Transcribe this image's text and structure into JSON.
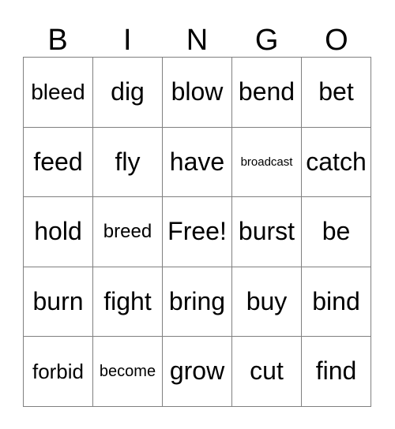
{
  "card": {
    "title_letters": [
      "B",
      "I",
      "N",
      "G",
      "O"
    ],
    "columns": 5,
    "rows": 5,
    "free_space_label": "Free!",
    "border_color": "#808080",
    "text_color": "#000000",
    "background_color": "#ffffff",
    "grid": [
      [
        {
          "label": "bleed",
          "size": "xl"
        },
        {
          "label": "dig",
          "size": "xxl"
        },
        {
          "label": "blow",
          "size": "xxl"
        },
        {
          "label": "bend",
          "size": "xxl"
        },
        {
          "label": "bet",
          "size": "xxl"
        }
      ],
      [
        {
          "label": "feed",
          "size": "xxl"
        },
        {
          "label": "fly",
          "size": "xxl"
        },
        {
          "label": "have",
          "size": "xxl"
        },
        {
          "label": "broadcast",
          "size": "xs"
        },
        {
          "label": "catch",
          "size": "xxl"
        }
      ],
      [
        {
          "label": "hold",
          "size": "xxl"
        },
        {
          "label": "breed",
          "size": "m"
        },
        {
          "label": "Free!",
          "size": "xxl"
        },
        {
          "label": "burst",
          "size": "xxl"
        },
        {
          "label": "be",
          "size": "xxl"
        }
      ],
      [
        {
          "label": "burn",
          "size": "xxl"
        },
        {
          "label": "fight",
          "size": "xxl"
        },
        {
          "label": "bring",
          "size": "xxl"
        },
        {
          "label": "buy",
          "size": "xxl"
        },
        {
          "label": "bind",
          "size": "xxl"
        }
      ],
      [
        {
          "label": "forbid",
          "size": "l"
        },
        {
          "label": "become",
          "size": "s"
        },
        {
          "label": "grow",
          "size": "xxl"
        },
        {
          "label": "cut",
          "size": "xxl"
        },
        {
          "label": "find",
          "size": "xxl"
        }
      ]
    ]
  }
}
